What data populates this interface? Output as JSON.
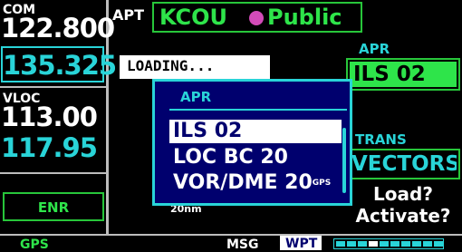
{
  "radios": {
    "com_label": "COM",
    "com_active": "122.800",
    "com_standby": "135.325",
    "vloc_label": "VLOC",
    "vloc_active": "113.00",
    "vloc_standby": "117.95"
  },
  "cdi_mode": "ENR",
  "header": {
    "apt_label": "APT",
    "ident": "KCOU",
    "type": "Public"
  },
  "map": {
    "loading_text": "LOADING...",
    "scale": "20nm"
  },
  "approach": {
    "label": "APR",
    "value": "ILS 02"
  },
  "transition": {
    "label": "TRANS",
    "value": "VECTORS"
  },
  "actions": {
    "load": "Load?",
    "activate": "Activate?"
  },
  "popup": {
    "title": "APR",
    "items": [
      "ILS 02",
      "LOC BC 20",
      "VOR/DME 20"
    ],
    "selected_index": 0,
    "gps_flag": "GPS"
  },
  "annunciators": {
    "gps": "GPS",
    "msg": "MSG",
    "wpt": "WPT"
  },
  "page_indicator": {
    "total": 10,
    "current": 3
  },
  "colors": {
    "green": "#2ee44a",
    "cyan": "#29d4d8",
    "popup_bg": "#00006e",
    "magenta": "#d34bb8"
  }
}
